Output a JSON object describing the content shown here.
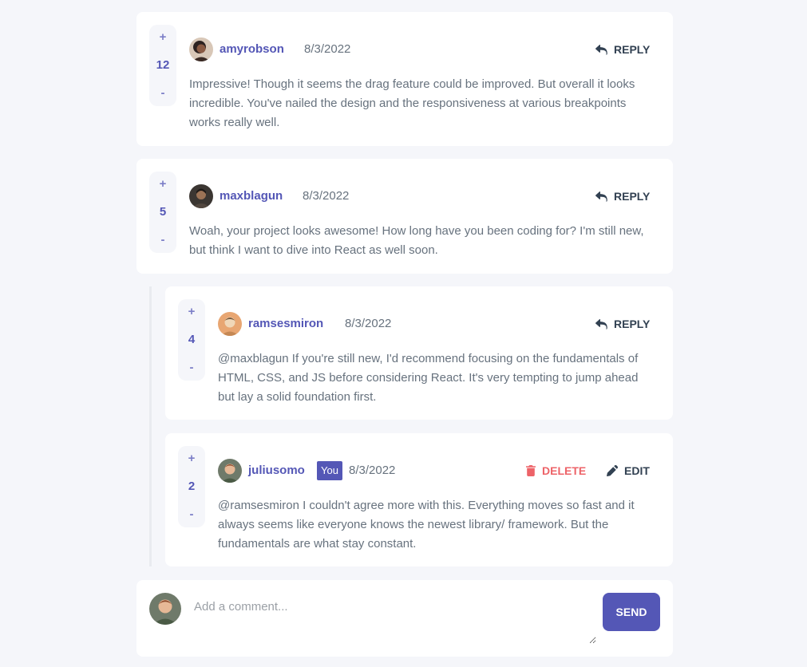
{
  "comments": [
    {
      "username": "amyrobson",
      "date": "8/3/2022",
      "score": "12",
      "text": "Impressive! Though it seems the drag feature could be improved. But overall it looks incredible. You've nailed the design and the responsiveness at various breakpoints works really well.",
      "reply_label": "REPLY"
    },
    {
      "username": "maxblagun",
      "date": "8/3/2022",
      "score": "5",
      "text": "Woah, your project looks awesome! How long have you been coding for? I'm still new, but think I want to dive into React as well soon.",
      "reply_label": "REPLY",
      "replies": [
        {
          "username": "ramsesmiron",
          "date": "8/3/2022",
          "score": "4",
          "text": "@maxblagun If you're still new, I'd recommend focusing on the fundamentals of HTML, CSS, and JS before considering React. It's very tempting to jump ahead but lay a solid foundation first.",
          "reply_label": "REPLY"
        },
        {
          "username": "juliusomo",
          "you_badge": "You",
          "date": "8/3/2022",
          "score": "2",
          "text": "@ramsesmiron I couldn't agree more with this. Everything moves so fast and it always seems like everyone knows the newest library/ framework. But the fundamentals are what stay constant.",
          "delete_label": "DELETE",
          "edit_label": "EDIT"
        }
      ]
    }
  ],
  "vote": {
    "plus": "+",
    "minus": "-"
  },
  "composer": {
    "placeholder": "Add a comment...",
    "send_label": "SEND"
  },
  "colors": {
    "background": "#f5f6fa",
    "accent": "#5457b6",
    "danger": "#ed6368",
    "heading": "#324152",
    "text": "#67727e"
  },
  "icons": {
    "reply": "reply-arrow-icon",
    "delete": "trash-icon",
    "edit": "pencil-icon"
  }
}
